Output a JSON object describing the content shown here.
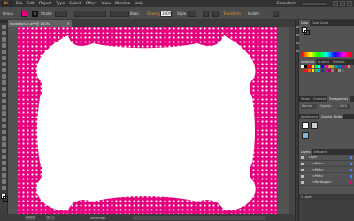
{
  "app": {
    "logo": "Ai"
  },
  "menu": [
    "File",
    "Edit",
    "Object",
    "Type",
    "Select",
    "Effect",
    "View",
    "Window",
    "Help"
  ],
  "workspace": {
    "label": "Essentials"
  },
  "control_bar": {
    "group_label": "Group",
    "stroke_label": "Stroke",
    "brush_value": "Basic",
    "opacity_label": "Opacity",
    "opacity_value": "100%",
    "style_label": "Style",
    "options": [
      "Transform",
      "Isolate"
    ],
    "fill_color": "#e6007e",
    "stroke_color": "#111111",
    "accent_color": "#f7941d"
  },
  "document_tab": {
    "title": "Invitation-5.ai* @ 150% (CMYK/Preview)",
    "close": "×"
  },
  "artboard": {
    "background_color": "#e6007e",
    "dot_color": "#ffffff",
    "frame_color": "#ffffff"
  },
  "status_bar": {
    "zoom": "150%",
    "page": "1",
    "tool": "Selection"
  },
  "panels": {
    "color": {
      "tabs": [
        "Color",
        "Color Guide"
      ]
    },
    "swatches": {
      "tabs": [
        "Swatches",
        "Brushes",
        "Symbols"
      ],
      "colors": [
        "#ffffff",
        "#000000",
        "#ff0000",
        "#ffff00",
        "#00ff00",
        "#00ffff",
        "#0000ff",
        "#ff00ff",
        "#f7941d",
        "#8dc63f",
        "#00a99d",
        "#0072bc",
        "#662d91",
        "#ec008c",
        "#c69c6d",
        "#754c24",
        "#ed1c24",
        "#f26522",
        "#fff200",
        "#39b54a",
        "#00aeef",
        "#2e3192",
        "#92278f",
        "#9e005d",
        "#a67c52",
        "#603913",
        "#999999",
        "#666666"
      ]
    },
    "transparency": {
      "tabs": [
        "Stroke",
        "Gradient",
        "Transparency"
      ],
      "mode": "Normal",
      "opacity_label": "Opacity",
      "opacity_value": "100%"
    },
    "graphic_styles": {
      "tabs": [
        "Appearance",
        "Graphic Styles"
      ]
    },
    "layers": {
      "tabs": [
        "Layers",
        "Artboards"
      ],
      "rows": [
        {
          "name": "Layer 1",
          "color": "#4f80ff"
        },
        {
          "name": "<Path>",
          "color": "#4f80ff"
        },
        {
          "name": "<Path>",
          "color": "#4f80ff"
        },
        {
          "name": "<Path>",
          "color": "#4f80ff"
        },
        {
          "name": "<Rectangle>",
          "color": "#e6007e"
        }
      ],
      "footer": "1 Layer"
    }
  }
}
